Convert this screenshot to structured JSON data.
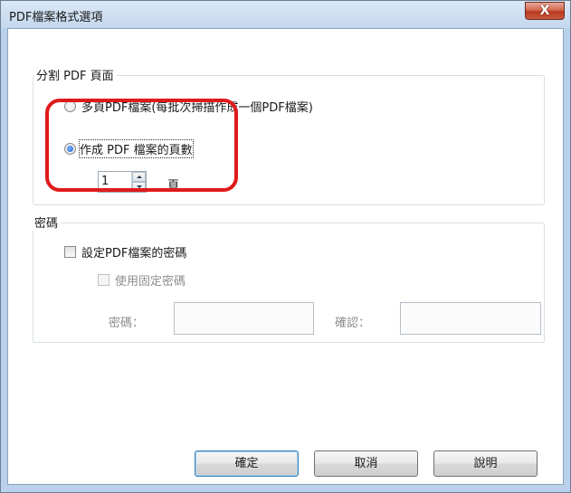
{
  "window": {
    "title": "PDF檔案格式選項",
    "close_glyph": "X"
  },
  "split_group": {
    "label": "分割 PDF 頁面",
    "option_multi": "多頁PDF檔案(每批次掃描作成一個PDF檔案)",
    "option_pages": "作成 PDF 檔案的頁數",
    "page_count": "1",
    "page_unit": "頁",
    "selected": "option_pages"
  },
  "password_group": {
    "label": "密碼",
    "set_password": "設定PDF檔案的密碼",
    "set_password_checked": false,
    "use_fixed": "使用固定密碼",
    "use_fixed_checked": false,
    "password_label": "密碼：",
    "confirm_label": "確認：",
    "password_value": "",
    "confirm_value": ""
  },
  "buttons": {
    "ok": "確定",
    "cancel": "取消",
    "help": "說明"
  },
  "colors": {
    "highlight": "#e01a1a",
    "close_button": "#c95a3c"
  }
}
